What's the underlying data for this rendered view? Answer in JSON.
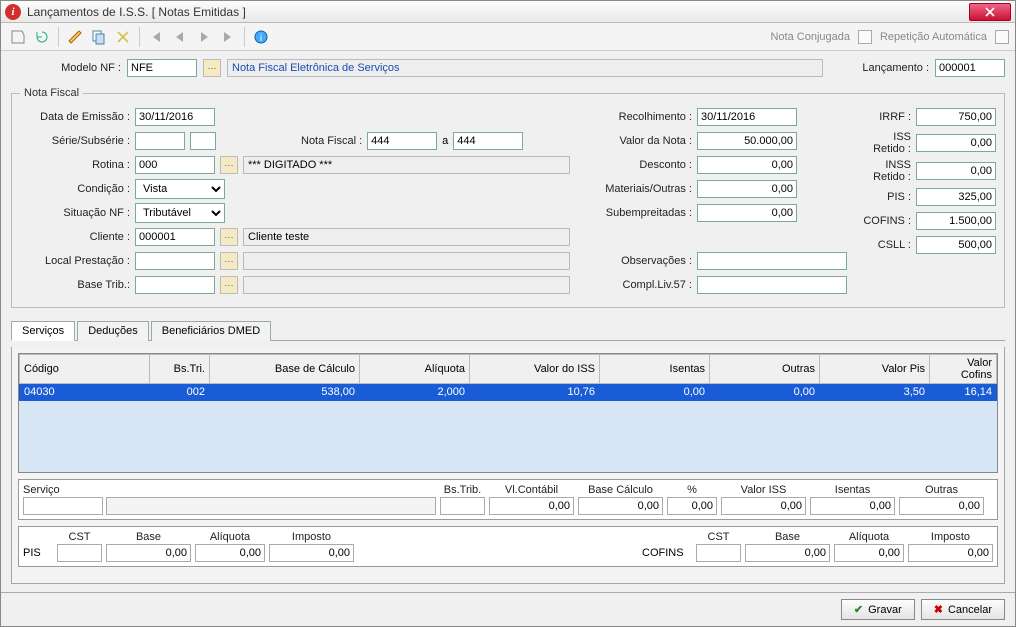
{
  "window": {
    "title": "Lançamentos de I.S.S. [ Notas Emitidas ]"
  },
  "toolbar": {
    "nota_conjugada": "Nota Conjugada",
    "repeticao": "Repetição Automática"
  },
  "header": {
    "modelo_label": "Modelo NF :",
    "modelo_value": "NFE",
    "modelo_desc": "Nota Fiscal Eletrônica de Serviços",
    "lancamento_label": "Lançamento :",
    "lancamento_value": "000001"
  },
  "nota": {
    "legend": "Nota Fiscal",
    "data_emissao_label": "Data de Emissão :",
    "data_emissao": "30/11/2016",
    "serie_label": "Série/Subsérie :",
    "serie": "",
    "subserie": "",
    "notafiscal_label": "Nota Fiscal :",
    "nf_de": "444",
    "nf_a_label": "a",
    "nf_ate": "444",
    "rotina_label": "Rotina :",
    "rotina": "000",
    "rotina_desc": "*** DIGITADO ***",
    "condicao_label": "Condição :",
    "condicao": "Vista",
    "situacao_label": "Situação NF :",
    "situacao": "Tributável",
    "cliente_label": "Cliente :",
    "cliente": "000001",
    "cliente_desc": "Cliente teste",
    "local_label": "Local Prestação :",
    "local": "",
    "basetrib_label": "Base Trib.:",
    "basetrib": "",
    "recolhimento_label": "Recolhimento :",
    "recolhimento": "30/11/2016",
    "valornota_label": "Valor da Nota :",
    "valornota": "50.000,00",
    "desconto_label": "Desconto :",
    "desconto": "0,00",
    "materiais_label": "Materiais/Outras :",
    "materiais": "0,00",
    "subemp_label": "Subempreitadas :",
    "subemp": "0,00",
    "observ_label": "Observações :",
    "observ": "",
    "compl57_label": "Compl.Liv.57 :",
    "compl57": "",
    "irrf_label": "IRRF :",
    "irrf": "750,00",
    "issret_label": "ISS Retido :",
    "issret": "0,00",
    "inssret_label": "INSS Retido :",
    "inssret": "0,00",
    "pis_label": "PIS :",
    "pis": "325,00",
    "cofins_label": "COFINS :",
    "cofins": "1.500,00",
    "csll_label": "CSLL :",
    "csll": "500,00"
  },
  "tabs": {
    "servicos": "Serviços",
    "deducoes": "Deduções",
    "beneficiarios": "Beneficiários DMED"
  },
  "grid": {
    "cols": {
      "codigo": "Código",
      "bstri": "Bs.Tri.",
      "basecalc": "Base de Cálculo",
      "aliq": "Alíquota",
      "valoriss": "Valor do ISS",
      "isentas": "Isentas",
      "outras": "Outras",
      "valorpis": "Valor Pis",
      "valorcofins": "Valor Cofins"
    },
    "rows": [
      {
        "codigo": "04030",
        "bstri": "002",
        "basecalc": "538,00",
        "aliq": "2,000",
        "valoriss": "10,76",
        "isentas": "0,00",
        "outras": "0,00",
        "valorpis": "3,50",
        "valorcofins": "16,14"
      }
    ]
  },
  "detail1": {
    "servico": "Serviço",
    "bstrib": "Bs.Trib.",
    "vlcontabil": "Vl.Contábil",
    "basecalc": "Base Cálculo",
    "pct": "%",
    "valoriss": "Valor ISS",
    "isentas": "Isentas",
    "outras": "Outras",
    "v_bstrib": "",
    "v_vlcontabil": "0,00",
    "v_basecalc": "0,00",
    "v_pct": "0,00",
    "v_valoriss": "0,00",
    "v_isentas": "0,00",
    "v_outras": "0,00"
  },
  "detail2": {
    "pis": "PIS",
    "cofins": "COFINS",
    "cst": "CST",
    "base": "Base",
    "aliquota": "Alíquota",
    "imposto": "Imposto",
    "pis_base": "0,00",
    "pis_aliq": "0,00",
    "pis_imp": "0,00",
    "cof_base": "0,00",
    "cof_aliq": "0,00",
    "cof_imp": "0,00"
  },
  "buttons": {
    "gravar": "Gravar",
    "cancelar": "Cancelar"
  }
}
